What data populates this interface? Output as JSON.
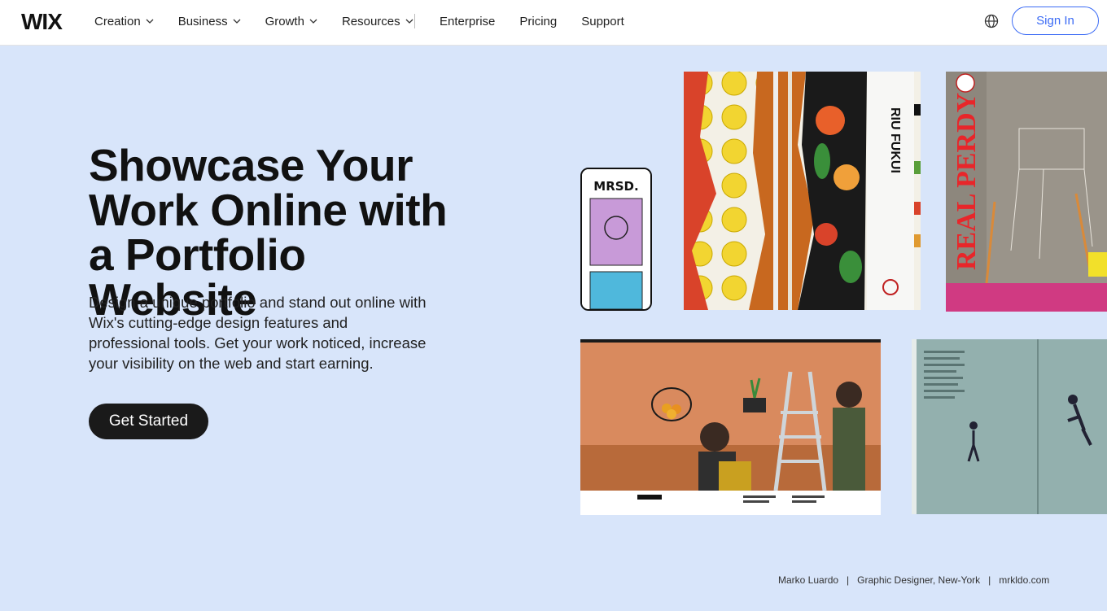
{
  "nav": {
    "items": [
      {
        "label": "Creation",
        "dropdown": true
      },
      {
        "label": "Business",
        "dropdown": true
      },
      {
        "label": "Growth",
        "dropdown": true
      },
      {
        "label": "Resources",
        "dropdown": true
      }
    ],
    "links": [
      "Enterprise",
      "Pricing",
      "Support"
    ],
    "sign_in": "Sign In",
    "brand": "WIX"
  },
  "hero": {
    "title": "Showcase Your Work Online with a Portfolio Website",
    "description": "Design a unique portfolio and stand out online with Wix's cutting-edge design features and professional tools. Get your work noticed, increase your visibility on the web and start earning.",
    "cta": "Get Started"
  },
  "collage": {
    "fukui_text": "RIU FUKUI",
    "real_text": "REAL PERDY",
    "phone_logo": "MRSD."
  },
  "credit": {
    "name": "Marko Luardo",
    "sep1": "|",
    "role": "Graphic Designer, New-York",
    "sep2": "|",
    "site": "mrkldo.com"
  },
  "colors": {
    "background": "#d8e5fa",
    "accent": "#3b6bf5",
    "cta_bg": "#1a1a1a"
  }
}
